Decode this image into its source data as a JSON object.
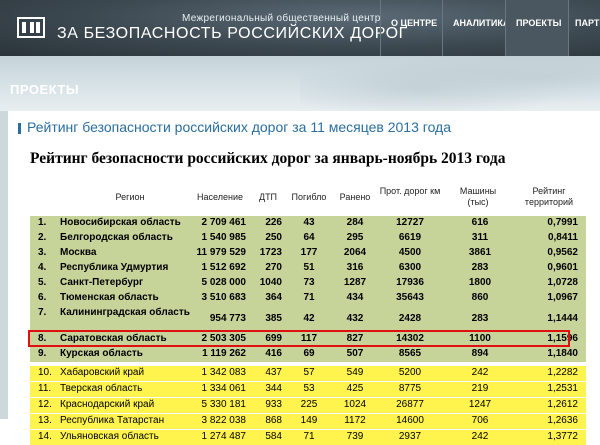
{
  "header": {
    "org_subtitle": "Межрегиональный общественный центр",
    "org_title": "ЗА БЕЗОПАСНОСТЬ РОССИЙСКИХ ДОРОГ",
    "nav": [
      "О ЦЕНТРЕ",
      "АНАЛИТИКА",
      "ПРОЕКТЫ",
      "ПАРТНЕ"
    ],
    "active_nav": "ПРОЕКТЫ"
  },
  "banner": {
    "title": "ПРОЕКТЫ"
  },
  "page": {
    "heading": "Рейтинг безопасности российских дорог за 11 месяцев 2013 года",
    "article_title": "Рейтинг безопасности российских дорог за январь-ноябрь 2013 года"
  },
  "table": {
    "headers": {
      "region": "Регион",
      "population": "Население",
      "dtp": "ДТП",
      "killed": "Погибло",
      "injured": "Ранено",
      "roads": "Прот. дорог км",
      "cars": "Машины (тыс)",
      "rating": "Рейтинг территорий"
    },
    "rows": [
      {
        "num": "1.",
        "region": "Новосибирская область",
        "population": "2 709 461",
        "dtp": "226",
        "killed": "43",
        "injured": "284",
        "roads": "12727",
        "cars": "616",
        "rating": "0,7991"
      },
      {
        "num": "2.",
        "region": "Белгородская область",
        "population": "1 540 985",
        "dtp": "250",
        "killed": "64",
        "injured": "295",
        "roads": "6619",
        "cars": "311",
        "rating": "0,8411"
      },
      {
        "num": "3.",
        "region": "Москва",
        "population": "11 979 529",
        "dtp": "1723",
        "killed": "177",
        "injured": "2064",
        "roads": "4500",
        "cars": "3861",
        "rating": "0,9562"
      },
      {
        "num": "4.",
        "region": "Республика Удмуртия",
        "population": "1 512 692",
        "dtp": "270",
        "killed": "51",
        "injured": "316",
        "roads": "6300",
        "cars": "283",
        "rating": "0,9601"
      },
      {
        "num": "5.",
        "region": "Санкт-Петербург",
        "population": "5 028 000",
        "dtp": "1040",
        "killed": "73",
        "injured": "1287",
        "roads": "17936",
        "cars": "1800",
        "rating": "1,0728"
      },
      {
        "num": "6.",
        "region": "Тюменская область",
        "population": "3 510 683",
        "dtp": "364",
        "killed": "71",
        "injured": "434",
        "roads": "35643",
        "cars": "860",
        "rating": "1,0967"
      },
      {
        "num": "7.",
        "region": "Калининградская область",
        "population": "954 773",
        "dtp": "385",
        "killed": "42",
        "injured": "432",
        "roads": "2428",
        "cars": "283",
        "rating": "1,1444"
      },
      {
        "num": "8.",
        "region": "Саратовская область",
        "population": "2 503 305",
        "dtp": "699",
        "killed": "117",
        "injured": "827",
        "roads": "14302",
        "cars": "1100",
        "rating": "1,1596"
      },
      {
        "num": "9.",
        "region": "Курская область",
        "population": "1 119 262",
        "dtp": "416",
        "killed": "69",
        "injured": "507",
        "roads": "8565",
        "cars": "894",
        "rating": "1,1840"
      },
      {
        "num": "10.",
        "region": "Хабаровский край",
        "population": "1 342 083",
        "dtp": "437",
        "killed": "57",
        "injured": "549",
        "roads": "5200",
        "cars": "242",
        "rating": "1,2282"
      },
      {
        "num": "11.",
        "region": "Тверская область",
        "population": "1 334 061",
        "dtp": "344",
        "killed": "53",
        "injured": "425",
        "roads": "8775",
        "cars": "219",
        "rating": "1,2531"
      },
      {
        "num": "12.",
        "region": "Краснодарский край",
        "population": "5 330 181",
        "dtp": "933",
        "killed": "225",
        "injured": "1024",
        "roads": "26877",
        "cars": "1247",
        "rating": "1,2612"
      },
      {
        "num": "13.",
        "region": "Республика Татарстан",
        "population": "3 822 038",
        "dtp": "868",
        "killed": "149",
        "injured": "1172",
        "roads": "14600",
        "cars": "706",
        "rating": "1,2636"
      },
      {
        "num": "14.",
        "region": "Ульяновская область",
        "population": "1 274 487",
        "dtp": "584",
        "killed": "71",
        "injured": "739",
        "roads": "2937",
        "cars": "242",
        "rating": "1,3772"
      }
    ]
  }
}
